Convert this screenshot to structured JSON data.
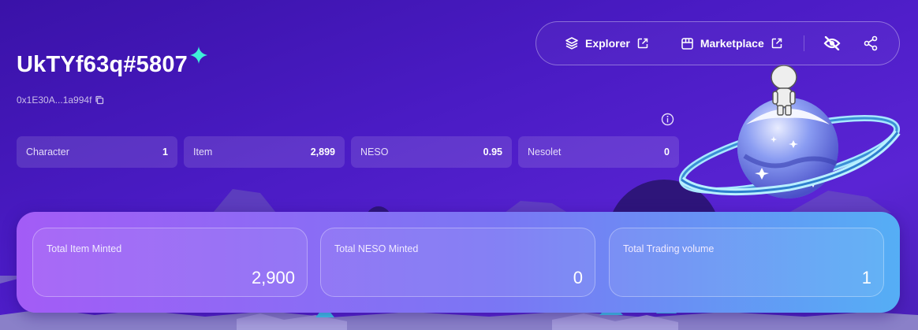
{
  "profile": {
    "name": "UkTYf63q#5807",
    "address": "0x1E30A...1a994f"
  },
  "nav": {
    "explorer_label": "Explorer",
    "marketplace_label": "Marketplace"
  },
  "stats": [
    {
      "label": "Character",
      "value": "1"
    },
    {
      "label": "Item",
      "value": "2,899"
    },
    {
      "label": "NESO",
      "value": "0.95"
    },
    {
      "label": "Nesolet",
      "value": "0"
    }
  ],
  "totals": [
    {
      "label": "Total Item Minted",
      "value": "2,900"
    },
    {
      "label": "Total NESO Minted",
      "value": "0"
    },
    {
      "label": "Total Trading volume",
      "value": "1"
    }
  ],
  "icons": {
    "sparkle": "sparkle-icon",
    "copy": "copy-icon",
    "explorer": "layers-icon",
    "external": "external-link-icon",
    "marketplace": "store-icon",
    "hide": "eye-off-icon",
    "share": "share-icon",
    "info": "info-icon"
  },
  "colors": {
    "background": "#4a1bc4",
    "sparkle": "#3ef0d8",
    "panel_start": "#a35cf6",
    "panel_end": "#55aef5"
  }
}
